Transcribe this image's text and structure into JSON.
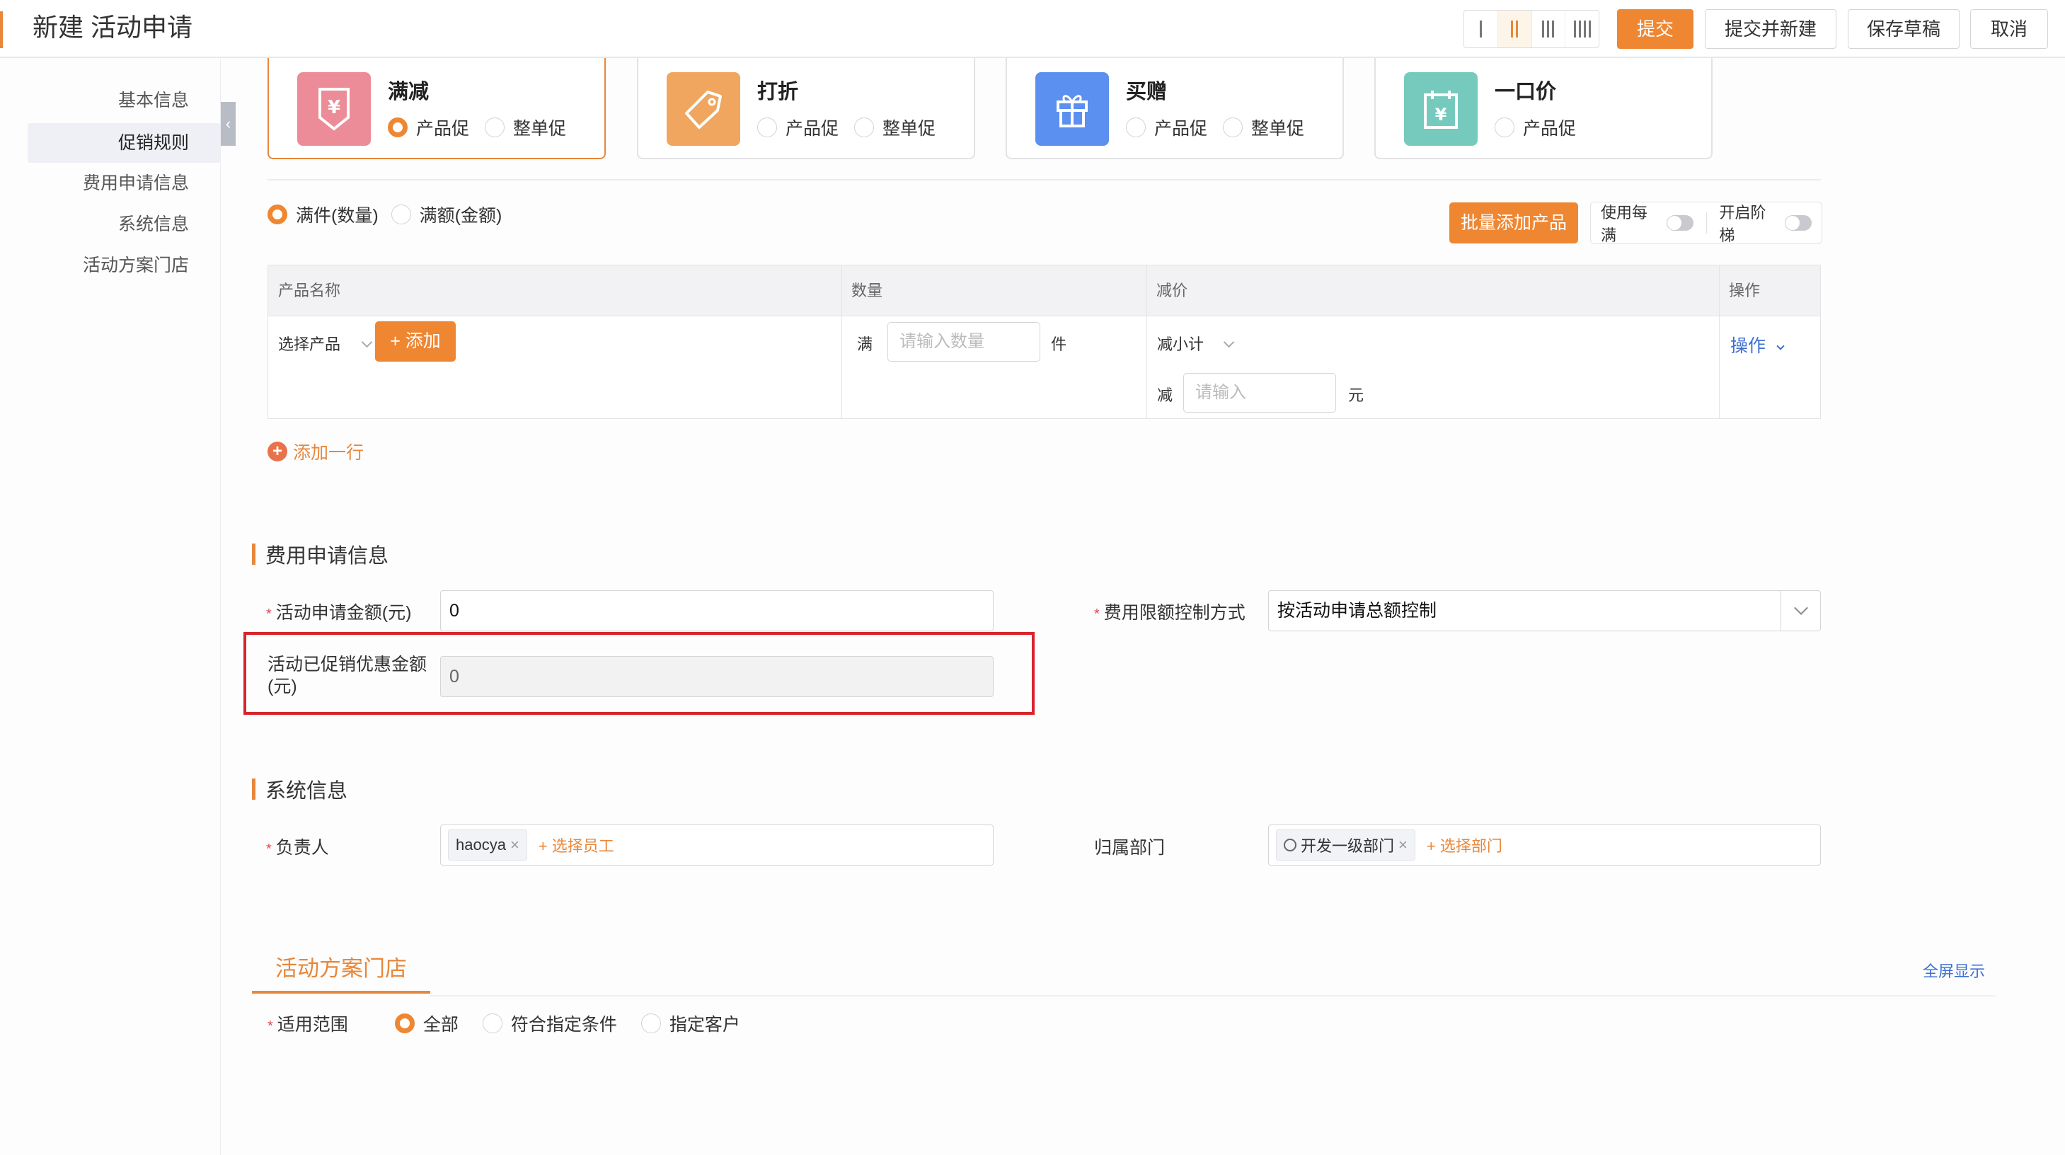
{
  "header": {
    "title": "新建 活动申请",
    "layout_options": [
      "I",
      "II",
      "III",
      "IIII"
    ],
    "layout_active_index": 1,
    "buttons": {
      "submit": "提交",
      "submit_and_new": "提交并新建",
      "save_draft": "保存草稿",
      "cancel": "取消"
    }
  },
  "sidebar": {
    "items": [
      {
        "label": "基本信息",
        "active": false
      },
      {
        "label": "促销规则",
        "active": true
      },
      {
        "label": "费用申请信息",
        "active": false
      },
      {
        "label": "系统信息",
        "active": false
      },
      {
        "label": "活动方案门店",
        "active": false
      }
    ],
    "collapse_icon": "chevron-left-icon"
  },
  "promo_types": [
    {
      "name": "满减",
      "icon": "yen-down-icon",
      "color": "#ec8c98",
      "selected": true,
      "options": [
        {
          "label": "产品促",
          "checked": true
        },
        {
          "label": "整单促",
          "checked": false
        }
      ]
    },
    {
      "name": "打折",
      "icon": "tag-icon",
      "color": "#f0a65e",
      "selected": false,
      "options": [
        {
          "label": "产品促",
          "checked": false
        },
        {
          "label": "整单促",
          "checked": false
        }
      ]
    },
    {
      "name": "买赠",
      "icon": "gift-icon",
      "color": "#5b8ff0",
      "selected": false,
      "options": [
        {
          "label": "产品促",
          "checked": false
        },
        {
          "label": "整单促",
          "checked": false
        }
      ]
    },
    {
      "name": "一口价",
      "icon": "calendar-yen-icon",
      "color": "#76cabd",
      "selected": false,
      "options": [
        {
          "label": "产品促",
          "checked": false
        }
      ]
    }
  ],
  "condition": {
    "options": [
      {
        "label": "满件(数量)",
        "checked": true
      },
      {
        "label": "满额(金额)",
        "checked": false
      }
    ],
    "batch_add_label": "批量添加产品",
    "toggles": [
      {
        "label": "使用每满",
        "on": false
      },
      {
        "label": "开启阶梯",
        "on": false
      }
    ]
  },
  "rule_table": {
    "headers": [
      "产品名称",
      "数量",
      "减价",
      "操作"
    ],
    "row": {
      "product_select": "选择产品",
      "add_button": "+ 添加",
      "qty_prefix": "满",
      "qty_placeholder": "请输入数量",
      "qty_suffix": "件",
      "discount_type": "减小计",
      "discount_prefix": "减",
      "discount_placeholder": "请输入",
      "discount_suffix": "元",
      "action_label": "操作"
    },
    "add_row_label": "添加一行"
  },
  "fee_section": {
    "title": "费用申请信息",
    "apply_amount_label": "活动申请金额(元)",
    "apply_amount_value": "0",
    "control_label": "费用限额控制方式",
    "control_value": "按活动申请总额控制",
    "promo_amount_label": "活动已促销优惠金额(元)",
    "promo_amount_value": "0"
  },
  "system_section": {
    "title": "系统信息",
    "owner_label": "负责人",
    "owner_tag": "haocya",
    "owner_add": "+ 选择员工",
    "dept_label": "归属部门",
    "dept_tag": "开发一级部门",
    "dept_add": "+ 选择部门"
  },
  "store_section": {
    "tab_label": "活动方案门店",
    "fullscreen_label": "全屏显示",
    "scope_label": "适用范围",
    "scope_options": [
      {
        "label": "全部",
        "checked": true
      },
      {
        "label": "符合指定条件",
        "checked": false
      },
      {
        "label": "指定客户",
        "checked": false
      }
    ]
  },
  "colors": {
    "accent": "#ef8632",
    "link": "#3c6fd1",
    "highlight_border": "#d9232d"
  }
}
